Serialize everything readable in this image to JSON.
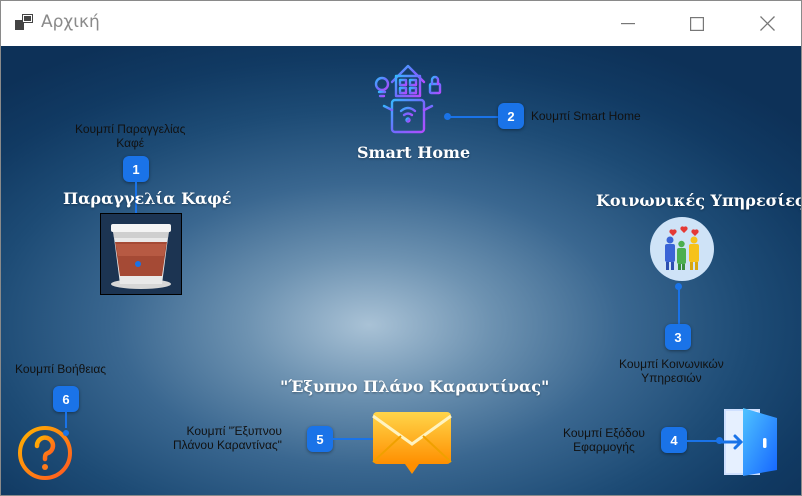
{
  "window": {
    "title": "Αρχική",
    "app_icon": "app-windows-icon",
    "controls": [
      "minimize-icon",
      "maximize-icon",
      "close-icon"
    ]
  },
  "main": {
    "smart_home": {
      "title": "Smart Home",
      "icon": "smart-home-icon"
    },
    "coffee": {
      "title": "Παραγγελία Καφέ",
      "icon": "coffee-cup-icon"
    },
    "social": {
      "title": "Κοινωνικές Υπηρεσίες",
      "icon": "people-hearts-icon"
    },
    "quarantine": {
      "title": "\"Έξυπνο Πλάνο Καραντίνας\"",
      "icon": "envelope-icon"
    },
    "help": {
      "icon": "question-mark-icon"
    },
    "exit": {
      "icon": "exit-door-icon"
    }
  },
  "callouts": [
    {
      "number": "1",
      "text_line1": "Κουμπί Παραγγελίας",
      "text_line2": "Καφέ"
    },
    {
      "number": "2",
      "text": "Κουμπί Smart Home"
    },
    {
      "number": "3",
      "text_line1": "Κουμπί Κοινωνικών",
      "text_line2": "Υπηρεσιών"
    },
    {
      "number": "4",
      "text_line1": "Κουμπί Εξόδου",
      "text_line2": "Εφαρμογής"
    },
    {
      "number": "5",
      "text_line1": "Κουμπί \"Έξυπνου",
      "text_line2": "Πλάνου Καραντίνας\""
    },
    {
      "number": "6",
      "text": "Κουμπί Βοήθειας"
    }
  ],
  "colors": {
    "accent": "#1a73e8",
    "background_dark": "#0d3158",
    "background_light": "#a9c2d6"
  }
}
